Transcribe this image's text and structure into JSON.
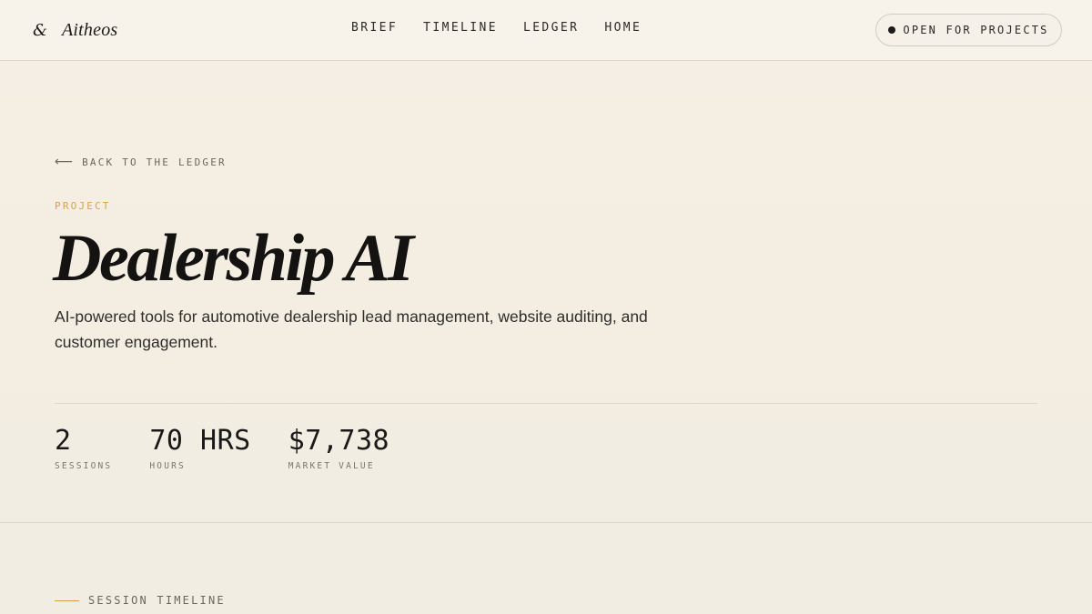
{
  "header": {
    "brand_mark": "&",
    "brand_name": "Aitheos",
    "nav": [
      "BRIEF",
      "TIMELINE",
      "LEDGER",
      "HOME"
    ],
    "status": "OPEN FOR PROJECTS"
  },
  "back_link": {
    "arrow": "⟵",
    "label": "BACK TO THE LEDGER"
  },
  "project": {
    "eyebrow": "PROJECT",
    "title": "Dealership AI",
    "description": "AI-powered tools for automotive dealership lead management, website auditing, and customer engagement."
  },
  "stats": [
    {
      "value": "2",
      "label": "SESSIONS"
    },
    {
      "value": "70 HRS",
      "label": "HOURS"
    },
    {
      "value": "$7,738",
      "label": "MARKET VALUE"
    }
  ],
  "section": {
    "label": "SESSION TIMELINE"
  },
  "colors": {
    "accent": "#d9a24a",
    "ink": "#1c1b1a",
    "background": "#f4efe6"
  }
}
